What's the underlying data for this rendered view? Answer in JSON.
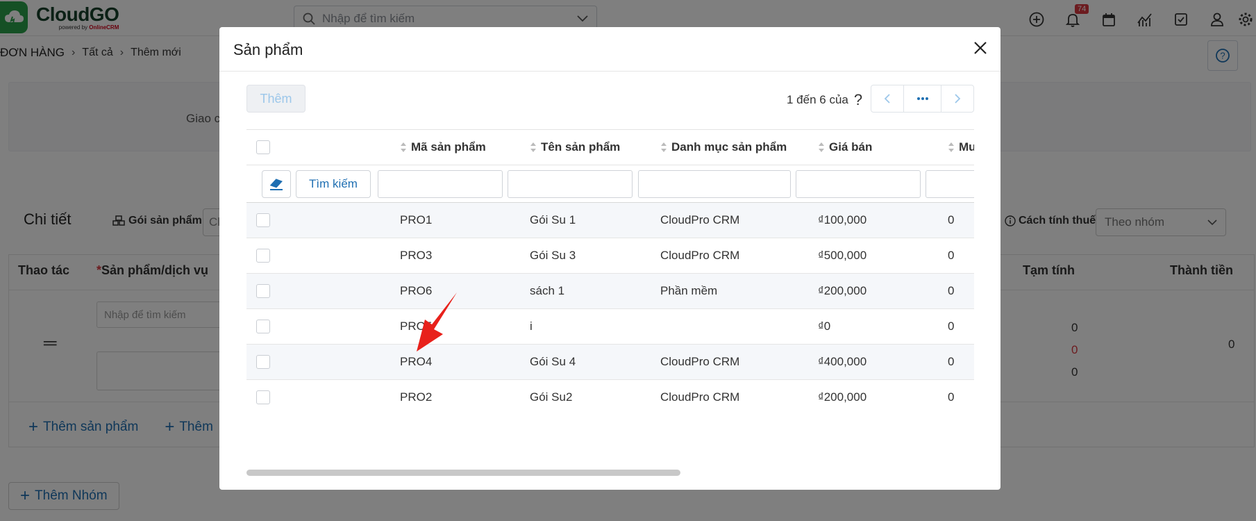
{
  "app": {
    "logo_name": "CloudGO",
    "logo_sub_prefix": "powered by ",
    "logo_sub_brand": "OnlineCRM",
    "global_search_placeholder": "Nhập để tìm kiếm",
    "notification_count": "74",
    "icons": [
      "plus-circle-icon",
      "bell-icon",
      "calendar-icon",
      "chart-icon",
      "checkbox-icon",
      "user-icon",
      "gear-icon"
    ]
  },
  "breadcrumb": {
    "root": "ĐƠN HÀNG",
    "items": [
      "Tất cả",
      "Thêm mới"
    ]
  },
  "info_card": {
    "label": "Giao c"
  },
  "detail": {
    "title": "Chi tiết",
    "bundle_label": "Gói sản phẩm",
    "bundle_value": "Cl",
    "tax_label": "Cách tính thuế",
    "tax_value": "Theo nhóm",
    "columns": {
      "action": "Thao tác",
      "product": "Sản phẩm/dịch vụ",
      "subtotal": "Tạm tính",
      "total": "Thành tiền"
    },
    "line_search_placeholder": "Nhập để tìm kiếm",
    "subtotal_values": [
      "0",
      "0",
      "0"
    ],
    "total_value": "0",
    "add_product": "Thêm sản phẩm",
    "add_other": "Thêm",
    "add_group": "Thêm Nhóm"
  },
  "modal": {
    "title": "Sản phẩm",
    "add_button": "Thêm",
    "pager_text": "1 đến 6 của",
    "pager_unknown": "?",
    "clear_filter_icon": "eraser-icon",
    "search_button": "Tìm kiếm",
    "columns": [
      "Mã sản phẩm",
      "Tên sản phẩm",
      "Danh mục sản phẩm",
      "Giá bán",
      "Mu"
    ],
    "rows": [
      {
        "code": "PRO1",
        "name": "Gói Su 1",
        "category": "CloudPro CRM",
        "price": "₫100,000",
        "qty": "0"
      },
      {
        "code": "PRO3",
        "name": "Gói Su 3",
        "category": "CloudPro CRM",
        "price": "₫500,000",
        "qty": "0"
      },
      {
        "code": "PRO6",
        "name": "sách 1",
        "category": "Phần mềm",
        "price": "₫200,000",
        "qty": "0"
      },
      {
        "code": "PRO5",
        "name": "i",
        "category": "",
        "price": "₫0",
        "qty": "0"
      },
      {
        "code": "PRO4",
        "name": "Gói Su 4",
        "category": "CloudPro CRM",
        "price": "₫400,000",
        "qty": "0"
      },
      {
        "code": "PRO2",
        "name": "Gói Su2",
        "category": "CloudPro CRM",
        "price": "₫200,000",
        "qty": "0"
      }
    ]
  },
  "colors": {
    "brand_green": "#2aa14b",
    "link_blue": "#1f6fb2",
    "badge_red": "#d9363e",
    "annotation_red": "#e8211b"
  }
}
